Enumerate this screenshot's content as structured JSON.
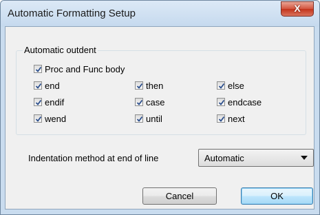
{
  "window": {
    "title": "Automatic Formatting Setup",
    "close_glyph": "X"
  },
  "outdent_group": {
    "title": "Automatic outdent",
    "checkboxes": {
      "proc_func": {
        "label": "Proc and Func body",
        "checked": true
      },
      "end": {
        "label": "end",
        "checked": true
      },
      "then": {
        "label": "then",
        "checked": true
      },
      "else": {
        "label": "else",
        "checked": true
      },
      "endif": {
        "label": "endif",
        "checked": true
      },
      "case": {
        "label": "case",
        "checked": true
      },
      "endcase": {
        "label": "endcase",
        "checked": true
      },
      "wend": {
        "label": "wend",
        "checked": true
      },
      "until": {
        "label": "until",
        "checked": true
      },
      "next": {
        "label": "next",
        "checked": true
      }
    }
  },
  "indentation": {
    "label": "Indentation method at end of line",
    "selected": "Automatic"
  },
  "buttons": {
    "cancel": "Cancel",
    "ok": "OK"
  }
}
